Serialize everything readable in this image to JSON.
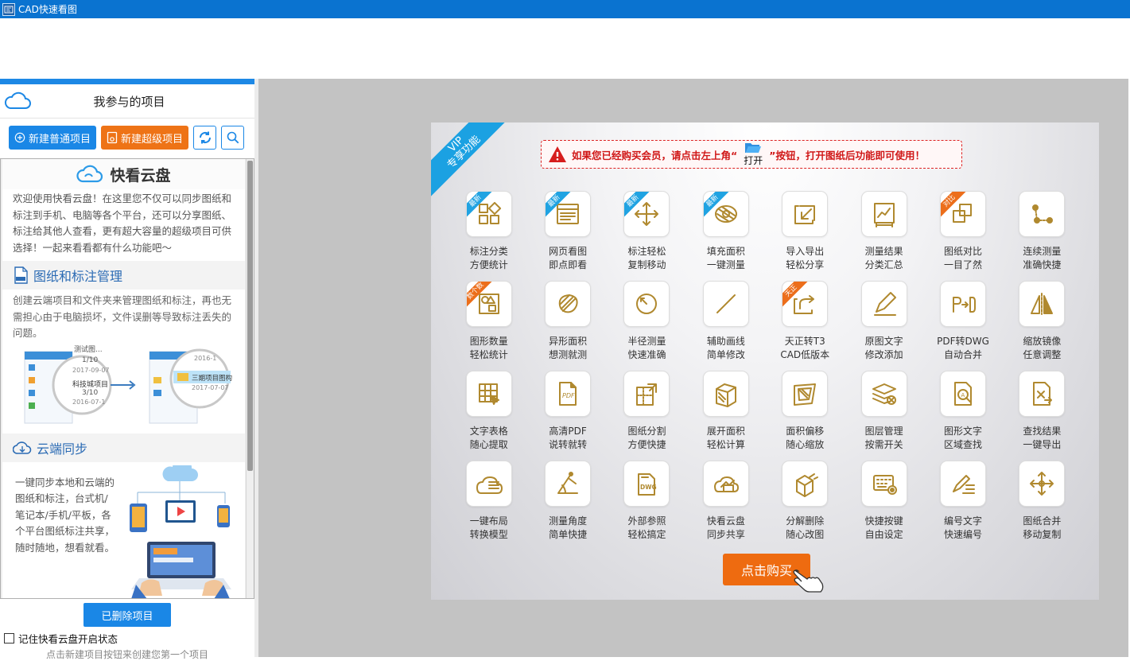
{
  "window": {
    "title": "CAD快速看图"
  },
  "left_panel": {
    "header_title": "我参与的项目",
    "buttons": {
      "new_normal": "新建普通项目",
      "new_super": "新建超级项目"
    },
    "cloud_disk": {
      "title": "快看云盘",
      "intro": "欢迎使用快看云盘！在这里您不仅可以同步图纸和标注到手机、电脑等各个平台，还可以分享图纸、标注给其他人查看，更有超大容量的超级项目可供选择！一起来看看都有什么功能吧～",
      "section1": {
        "title": "图纸和标注管理",
        "text": "创建云端项目和文件夹来管理图纸和标注，再也无需担心由于电脑损坏，文件误删等导致标注丢失的问题。",
        "illus": {
          "item1": "测试图...",
          "page1": "1/10",
          "date1": "2017-09-07",
          "item2": "科技城项目",
          "page2": "3/10",
          "date2": "2016-07-1",
          "item3": "三期项目图构",
          "date3": "2017-07-07",
          "date4": "2016-1"
        }
      },
      "section2": {
        "title": "云端同步",
        "text": "一键同步本地和云端的图纸和标注，台式机/笔记本/手机/平板，各个平台图纸标注共享，随时随地，想看就看。"
      }
    },
    "deleted_button": "已删除项目",
    "remember_label": "记住快看云盘开启状态",
    "hint": "点击新建项目按钮来创建您第一个项目"
  },
  "vip_panel": {
    "ribbon": [
      "VIP",
      "专享功能"
    ],
    "notice_before": "如果您已经购买会员，请点击左上角“",
    "open_label": "打开",
    "notice_after": "”按钮，打开图纸后功能即可使用！",
    "features": [
      {
        "l1": "标注分类",
        "l2": "方便统计",
        "tag": "最新",
        "tagc": "blue",
        "icon": "classify-icon"
      },
      {
        "l1": "网页看图",
        "l2": "即点即看",
        "tag": "最新",
        "tagc": "blue",
        "icon": "webpage-icon"
      },
      {
        "l1": "标注轻松",
        "l2": "复制移动",
        "tag": "最新",
        "tagc": "blue",
        "icon": "move-icon"
      },
      {
        "l1": "填充面积",
        "l2": "一键测量",
        "tag": "最新",
        "tagc": "blue",
        "icon": "fill-area-icon"
      },
      {
        "l1": "导入导出",
        "l2": "轻松分享",
        "tag": "",
        "tagc": "",
        "icon": "import-export-icon"
      },
      {
        "l1": "测量结果",
        "l2": "分类汇总",
        "tag": "",
        "tagc": "",
        "icon": "measure-summary-icon"
      },
      {
        "l1": "图纸对比",
        "l2": "一目了然",
        "tag": "对比",
        "tagc": "orange",
        "icon": "compare-icon"
      },
      {
        "l1": "连续测量",
        "l2": "准确快捷",
        "tag": "",
        "tagc": "",
        "icon": "continuous-measure-icon"
      },
      {
        "l1": "图形数量",
        "l2": "轻松统计",
        "tag": "数个数",
        "tagc": "orange",
        "icon": "shape-count-icon"
      },
      {
        "l1": "异形面积",
        "l2": "想测就测",
        "tag": "",
        "tagc": "",
        "icon": "irregular-area-icon"
      },
      {
        "l1": "半径测量",
        "l2": "快速准确",
        "tag": "",
        "tagc": "",
        "icon": "radius-icon"
      },
      {
        "l1": "辅助画线",
        "l2": "简单修改",
        "tag": "",
        "tagc": "",
        "icon": "line-icon"
      },
      {
        "l1": "天正转T3",
        "l2": "CAD低版本",
        "tag": "天正",
        "tagc": "orange",
        "icon": "convert-icon"
      },
      {
        "l1": "原图文字",
        "l2": "修改添加",
        "tag": "",
        "tagc": "",
        "icon": "edit-text-icon"
      },
      {
        "l1": "PDF转DWG",
        "l2": "自动合并",
        "tag": "",
        "tagc": "",
        "icon": "pdf-dwg-icon"
      },
      {
        "l1": "缩放镜像",
        "l2": "任意调整",
        "tag": "",
        "tagc": "",
        "icon": "mirror-icon"
      },
      {
        "l1": "文字表格",
        "l2": "随心提取",
        "tag": "",
        "tagc": "",
        "icon": "table-extract-icon"
      },
      {
        "l1": "高清PDF",
        "l2": "说转就转",
        "tag": "",
        "tagc": "",
        "icon": "pdf-icon"
      },
      {
        "l1": "图纸分割",
        "l2": "方便快捷",
        "tag": "",
        "tagc": "",
        "icon": "split-icon"
      },
      {
        "l1": "展开面积",
        "l2": "轻松计算",
        "tag": "",
        "tagc": "",
        "icon": "unfold-area-icon"
      },
      {
        "l1": "面积偏移",
        "l2": "随心缩放",
        "tag": "",
        "tagc": "",
        "icon": "area-offset-icon"
      },
      {
        "l1": "图层管理",
        "l2": "按需开关",
        "tag": "",
        "tagc": "",
        "icon": "layers-icon"
      },
      {
        "l1": "图形文字",
        "l2": "区域查找",
        "tag": "",
        "tagc": "",
        "icon": "find-icon"
      },
      {
        "l1": "查找结果",
        "l2": "一键导出",
        "tag": "",
        "tagc": "",
        "icon": "export-results-icon"
      },
      {
        "l1": "一键布局",
        "l2": "转换模型",
        "tag": "",
        "tagc": "",
        "icon": "layout-icon"
      },
      {
        "l1": "测量角度",
        "l2": "简单快捷",
        "tag": "",
        "tagc": "",
        "icon": "angle-icon"
      },
      {
        "l1": "外部参照",
        "l2": "轻松搞定",
        "tag": "",
        "tagc": "",
        "icon": "xref-icon"
      },
      {
        "l1": "快看云盘",
        "l2": "同步共享",
        "tag": "",
        "tagc": "",
        "icon": "cloud-share-icon"
      },
      {
        "l1": "分解删除",
        "l2": "随心改图",
        "tag": "",
        "tagc": "",
        "icon": "explode-icon"
      },
      {
        "l1": "快捷按键",
        "l2": "自由设定",
        "tag": "",
        "tagc": "",
        "icon": "hotkey-icon"
      },
      {
        "l1": "编号文字",
        "l2": "快速编号",
        "tag": "",
        "tagc": "",
        "icon": "numbering-icon"
      },
      {
        "l1": "图纸合并",
        "l2": "移动复制",
        "tag": "",
        "tagc": "",
        "icon": "merge-icon"
      }
    ],
    "buy_label": "点击购买",
    "colors": {
      "icon_gold": "#b0892f",
      "buy_orange": "#ee6b10",
      "tag_blue": "#20a3e2",
      "tag_orange": "#ec6e1b"
    }
  }
}
